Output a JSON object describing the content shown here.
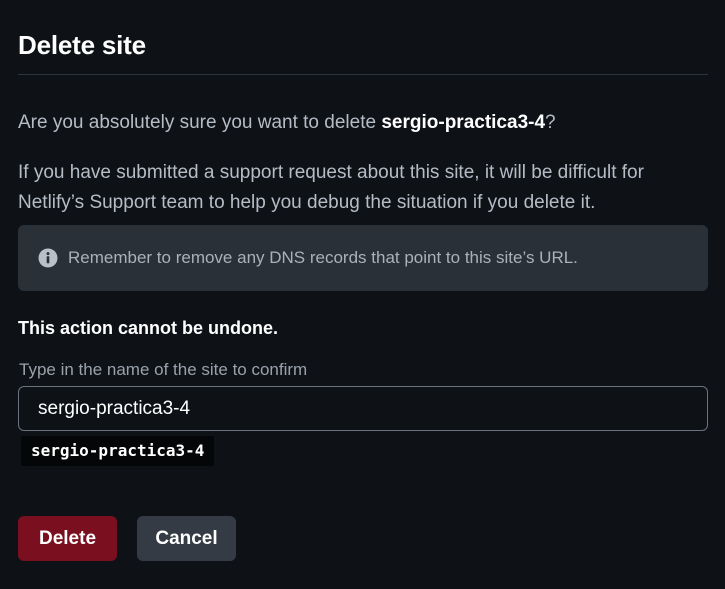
{
  "dialog": {
    "title": "Delete site",
    "question_prefix": "Are you absolutely sure you want to delete ",
    "site_name": "sergio-practica3-4",
    "question_suffix": "?",
    "support_text": "If you have submitted a support request about this site, it will be difficult for Netlify’s Support team to help you debug the situation if you delete it.",
    "notice_icon": "info-circle-icon",
    "notice_text": "Remember to remove any DNS records that point to this site’s URL.",
    "warning_text": "This action cannot be undone.",
    "confirm_label": "Type in the name of the site to confirm",
    "confirm_value": "sergio-practica3-4",
    "confirm_hint": "sergio-practica3-4"
  },
  "actions": {
    "delete_label": "Delete",
    "cancel_label": "Cancel"
  },
  "colors": {
    "background": "#0e1217",
    "notice_background": "#2a3038",
    "delete_button": "#7a0f20",
    "cancel_button": "#343b45"
  }
}
